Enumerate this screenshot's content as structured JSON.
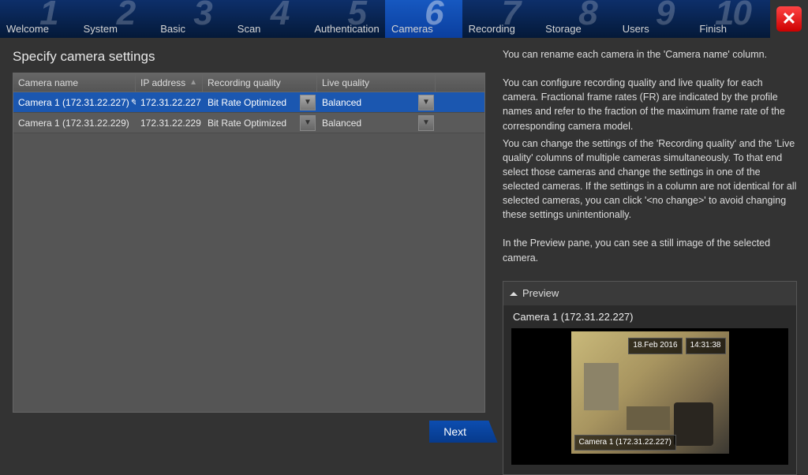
{
  "steps": [
    {
      "num": "1",
      "label": "Welcome"
    },
    {
      "num": "2",
      "label": "System"
    },
    {
      "num": "3",
      "label": "Basic"
    },
    {
      "num": "4",
      "label": "Scan"
    },
    {
      "num": "5",
      "label": "Authentication"
    },
    {
      "num": "6",
      "label": "Cameras"
    },
    {
      "num": "7",
      "label": "Recording"
    },
    {
      "num": "8",
      "label": "Storage"
    },
    {
      "num": "9",
      "label": "Users"
    },
    {
      "num": "10",
      "label": "Finish"
    }
  ],
  "page_title": "Specify camera settings",
  "table": {
    "headers": {
      "name": "Camera name",
      "ip": "IP address",
      "rec": "Recording quality",
      "live": "Live quality"
    },
    "rows": [
      {
        "name": "Camera 1 (172.31.22.227)",
        "ip": "172.31.22.227",
        "rec": "Bit Rate Optimized",
        "live": "Balanced",
        "selected": true
      },
      {
        "name": "Camera 1 (172.31.22.229)",
        "ip": "172.31.22.229",
        "rec": "Bit Rate Optimized",
        "live": "Balanced",
        "selected": false
      }
    ]
  },
  "next_label": "Next",
  "help": {
    "p1": "You can rename each camera in the 'Camera name' column.",
    "p2": "You can configure recording quality and live quality for each camera. Fractional frame rates (FR) are indicated by the profile names and refer to the fraction of the maximum frame rate of the corresponding camera model.",
    "p3": "You can change the settings of the 'Recording quality' and the 'Live quality' columns of multiple cameras simultaneously. To that end select those cameras and change the settings in one of the selected cameras. If the settings in a column are not identical for all selected cameras, you can click '<no change>' to avoid changing these settings unintentionally.",
    "p4": "In the Preview pane, you can see a still image of the selected camera."
  },
  "preview": {
    "header": "Preview",
    "title": "Camera 1 (172.31.22.227)",
    "date": "18.Feb 2016",
    "time": "14:31:38",
    "overlay_label": "Camera 1 (172.31.22.227)"
  }
}
